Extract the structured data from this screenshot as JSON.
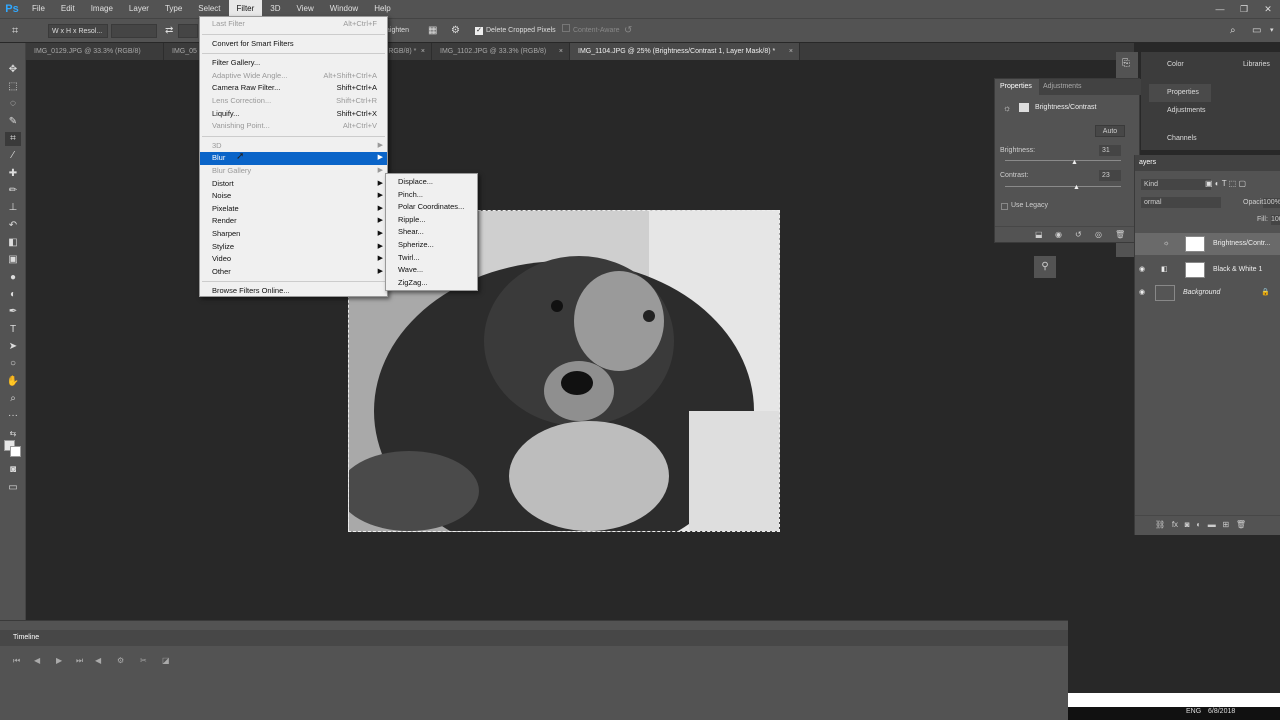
{
  "app": {
    "logo": "Ps"
  },
  "menubar": {
    "items": [
      "File",
      "Edit",
      "Image",
      "Layer",
      "Type",
      "Select",
      "Filter",
      "3D",
      "View",
      "Window",
      "Help"
    ],
    "active_index": 6
  },
  "options": {
    "ratio": "W x H x Resol...",
    "straighten": "aighten",
    "delete_cropped": "Delete Cropped Pixels",
    "content_aware": "Content-Aware"
  },
  "tabs": [
    {
      "label": "IMG_0129.JPG @ 33.3% (RGB/8)",
      "active": false
    },
    {
      "label": "IMG_05",
      "active": false
    },
    {
      "label": "(RGB/8) *",
      "active": false
    },
    {
      "label": "IMG_1102.JPG @ 33.3% (RGB/8)",
      "active": false
    },
    {
      "label": "IMG_1104.JPG @ 25% (Brightness/Contrast 1, Layer Mask/8) *",
      "active": true
    }
  ],
  "filter_menu": {
    "items": [
      {
        "label": "Last Filter",
        "shortcut": "Alt+Ctrl+F",
        "disabled": true
      },
      {
        "sep": true
      },
      {
        "label": "Convert for Smart Filters"
      },
      {
        "sep": true
      },
      {
        "label": "Filter Gallery..."
      },
      {
        "label": "Adaptive Wide Angle...",
        "shortcut": "Alt+Shift+Ctrl+A",
        "disabled": true
      },
      {
        "label": "Camera Raw Filter...",
        "shortcut": "Shift+Ctrl+A"
      },
      {
        "label": "Lens Correction...",
        "shortcut": "Shift+Ctrl+R",
        "disabled": true
      },
      {
        "label": "Liquify...",
        "shortcut": "Shift+Ctrl+X"
      },
      {
        "label": "Vanishing Point...",
        "shortcut": "Alt+Ctrl+V",
        "disabled": true
      },
      {
        "sep": true
      },
      {
        "label": "3D",
        "submenu": true,
        "disabled": true
      },
      {
        "label": "Blur",
        "submenu": true,
        "highlighted": true
      },
      {
        "label": "Blur Gallery",
        "submenu": true,
        "disabled": true
      },
      {
        "label": "Distort",
        "submenu": true
      },
      {
        "label": "Noise",
        "submenu": true
      },
      {
        "label": "Pixelate",
        "submenu": true
      },
      {
        "label": "Render",
        "submenu": true
      },
      {
        "label": "Sharpen",
        "submenu": true
      },
      {
        "label": "Stylize",
        "submenu": true
      },
      {
        "label": "Video",
        "submenu": true
      },
      {
        "label": "Other",
        "submenu": true
      },
      {
        "sep": true
      },
      {
        "label": "Browse Filters Online..."
      }
    ]
  },
  "distort_submenu": [
    "Displace...",
    "Pinch...",
    "Polar Coordinates...",
    "Ripple...",
    "Shear...",
    "Spherize...",
    "Twirl...",
    "Wave...",
    "ZigZag..."
  ],
  "right_strip": {
    "top": [
      "Color",
      "Libraries"
    ],
    "side": [
      "Properties",
      "Adjustments",
      "Channels"
    ]
  },
  "properties": {
    "tabs": [
      "Properties",
      "Adjustments"
    ],
    "title": "Brightness/Contrast",
    "auto": "Auto",
    "brightness_label": "Brightness:",
    "brightness_value": "31",
    "contrast_label": "Contrast:",
    "contrast_value": "23",
    "use_legacy": "Use Legacy"
  },
  "layers": {
    "title": "ayers",
    "kind": "Kind",
    "blend": "ormal",
    "opacity_label": "Opacity:",
    "opacity_value": "100%",
    "fill_label": "Fill:",
    "fill_value": "100%",
    "rows": [
      "Brightness/Contr...",
      "Black & White 1",
      "Background"
    ]
  },
  "timeline": {
    "title": "Timeline"
  },
  "taskbar": {
    "date": "6/8/2018",
    "lang": "ENG"
  }
}
